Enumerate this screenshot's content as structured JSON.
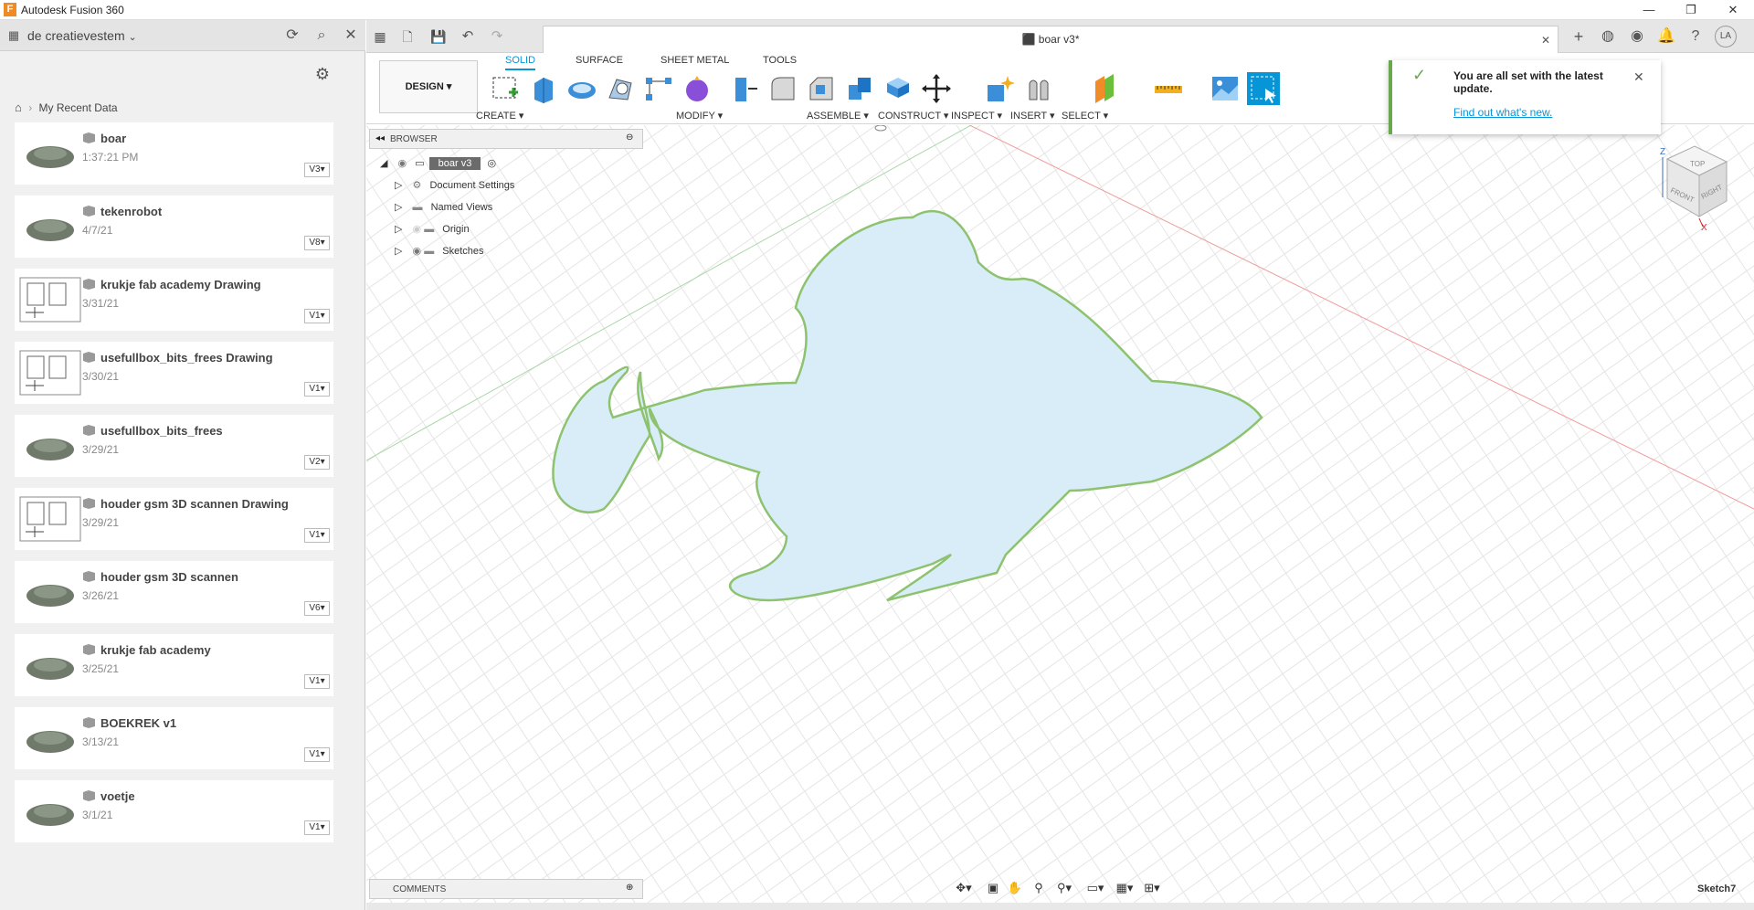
{
  "app": {
    "title": "Autodesk Fusion 360",
    "window_min": "—",
    "window_max": "❐",
    "window_close": "✕"
  },
  "left_panel": {
    "team": "de creatievestem",
    "breadcrumb": "My Recent Data",
    "items": [
      {
        "name": "boar",
        "date": "1:37:21 PM",
        "version": "V3",
        "type": "design"
      },
      {
        "name": "tekenrobot",
        "date": "4/7/21",
        "version": "V8",
        "type": "design"
      },
      {
        "name": "krukje fab academy Drawing",
        "date": "3/31/21",
        "version": "V1",
        "type": "drawing"
      },
      {
        "name": "usefullbox_bits_frees Drawing",
        "date": "3/30/21",
        "version": "V1",
        "type": "drawing"
      },
      {
        "name": "usefullbox_bits_frees",
        "date": "3/29/21",
        "version": "V2",
        "type": "design"
      },
      {
        "name": "houder gsm 3D scannen Drawing",
        "date": "3/29/21",
        "version": "V1",
        "type": "drawing"
      },
      {
        "name": "houder gsm 3D scannen",
        "date": "3/26/21",
        "version": "V6",
        "type": "design"
      },
      {
        "name": "krukje fab academy",
        "date": "3/25/21",
        "version": "V1",
        "type": "design"
      },
      {
        "name": "BOEKREK v1",
        "date": "3/13/21",
        "version": "V1",
        "type": "design"
      },
      {
        "name": "voetje",
        "date": "3/1/21",
        "version": "V1",
        "type": "design"
      }
    ]
  },
  "document": {
    "tab_title": "boar v3*",
    "user_initials": "LA"
  },
  "toolbar": {
    "workspace": "DESIGN ▾",
    "tabs": [
      "SOLID",
      "SURFACE",
      "SHEET METAL",
      "TOOLS"
    ],
    "active_tab": "SOLID",
    "groups": [
      "CREATE ▾",
      "MODIFY ▾",
      "ASSEMBLE ▾",
      "CONSTRUCT ▾",
      "INSPECT ▾",
      "INSERT ▾",
      "SELECT ▾"
    ]
  },
  "browser": {
    "header": "BROWSER",
    "root": "boar v3",
    "nodes": [
      "Document Settings",
      "Named Views",
      "Origin",
      "Sketches"
    ]
  },
  "comments": {
    "header": "COMMENTS"
  },
  "toast": {
    "message": "You are all set with the latest update.",
    "link": "Find out what's new."
  },
  "viewcube": {
    "top": "TOP",
    "front": "FRONT",
    "right": "RIGHT",
    "z": "Z",
    "x": "X"
  },
  "status": {
    "active_sketch": "Sketch7"
  },
  "colors": {
    "accent": "#0696d7",
    "sketch_fill": "#d9edf9",
    "sketch_line": "#8dc26f",
    "brand": "#f08a24"
  }
}
